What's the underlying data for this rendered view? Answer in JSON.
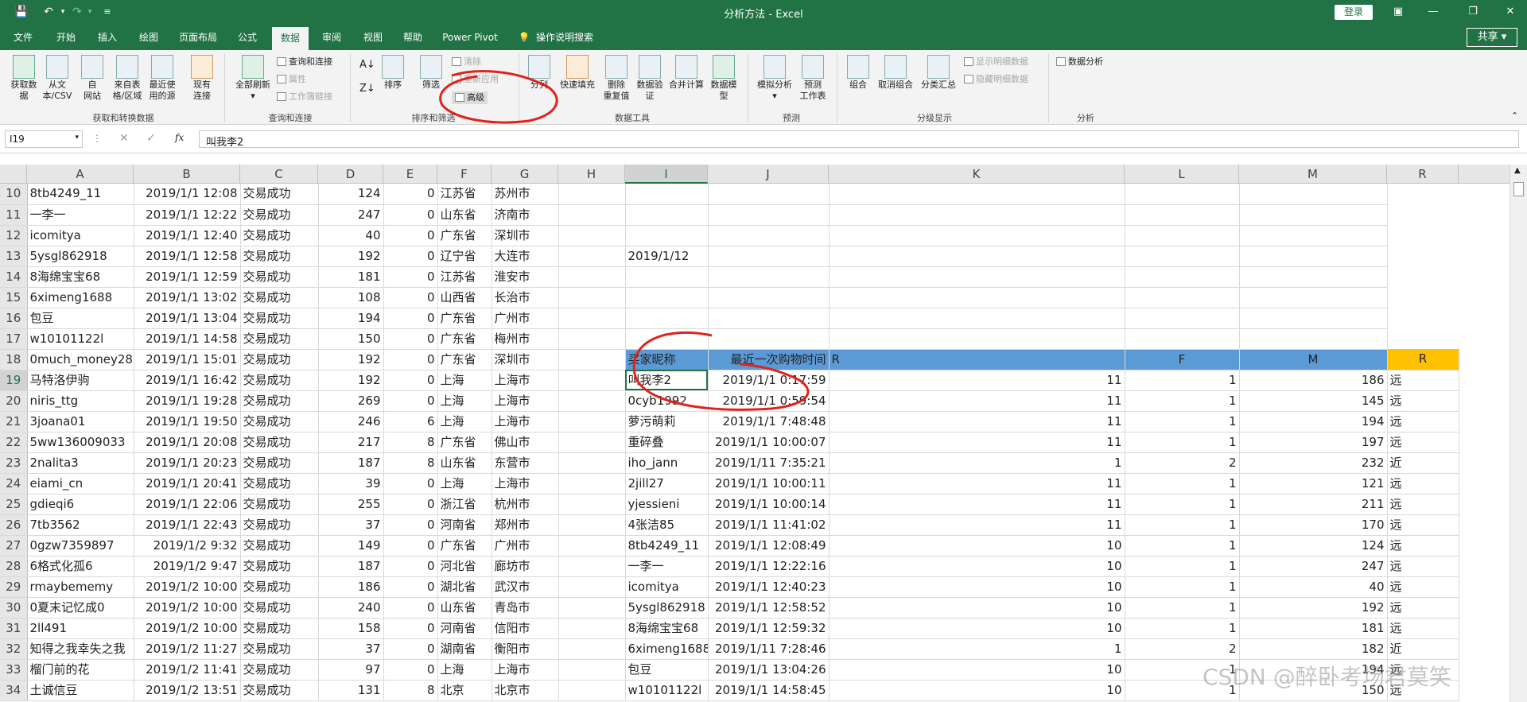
{
  "window": {
    "title": "分析方法  -  Excel",
    "login": "登录",
    "share": "共享"
  },
  "menu": {
    "tabs": [
      "文件",
      "开始",
      "插入",
      "绘图",
      "页面布局",
      "公式",
      "数据",
      "审阅",
      "视图",
      "帮助",
      "Power Pivot"
    ],
    "tell_me": "操作说明搜索"
  },
  "ribbon": {
    "get_data": [
      "获取数",
      "据"
    ],
    "from_csv": [
      "从文",
      "本/CSV"
    ],
    "from_web": [
      "自",
      "网站"
    ],
    "from_table": [
      "来自表",
      "格/区域"
    ],
    "recent": [
      "最近使",
      "用的源"
    ],
    "existing": [
      "现有",
      "连接"
    ],
    "group1": "获取和转换数据",
    "refresh_all": [
      "全部刷新"
    ],
    "queries": "查询和连接",
    "props": "属性",
    "edit_links": "工作簿链接",
    "group2": "查询和连接",
    "sort_label": "排序",
    "filter_label": "筛选",
    "clear": "清除",
    "reapply": "重新应用",
    "advanced": "高级",
    "group3": "排序和筛选",
    "split": "分列",
    "flash_fill": "快速填充",
    "remove_dup": [
      "删除",
      "重复值"
    ],
    "validate": [
      "数据验",
      "证"
    ],
    "consolidate": "合并计算",
    "model": [
      "数据模",
      "型"
    ],
    "group4": "数据工具",
    "what_if": [
      "模拟分析"
    ],
    "forecast": [
      "预测",
      "工作表"
    ],
    "group5": "预测",
    "grp_btn": "组合",
    "ungroup": "取消组合",
    "subtotal": "分类汇总",
    "show_detail": "显示明细数据",
    "hide_detail": "隐藏明细数据",
    "group6": "分级显示",
    "analysis": "数据分析",
    "group7": "分析"
  },
  "formula_bar": {
    "name_box": "I19",
    "formula": "叫我李2"
  },
  "columns": [
    "A",
    "B",
    "C",
    "D",
    "E",
    "F",
    "G",
    "H",
    "I",
    "J",
    "K",
    "L",
    "M",
    "R"
  ],
  "rows": [
    [
      "10",
      "8tb4249_11",
      "2019/1/1 12:08",
      "交易成功",
      "124",
      "0",
      "江苏省",
      "苏州市",
      "",
      "",
      "",
      "",
      "",
      ""
    ],
    [
      "11",
      "一李一",
      "2019/1/1 12:22",
      "交易成功",
      "247",
      "0",
      "山东省",
      "济南市",
      "",
      "",
      "",
      "",
      "",
      ""
    ],
    [
      "12",
      "icomitya",
      "2019/1/1 12:40",
      "交易成功",
      "40",
      "0",
      "广东省",
      "深圳市",
      "",
      "",
      "",
      "",
      "",
      ""
    ],
    [
      "13",
      "5ysgl862918",
      "2019/1/1 12:58",
      "交易成功",
      "192",
      "0",
      "辽宁省",
      "大连市",
      "",
      "2019/1/12",
      "",
      "",
      "",
      ""
    ],
    [
      "14",
      "8海绵宝宝68",
      "2019/1/1 12:59",
      "交易成功",
      "181",
      "0",
      "江苏省",
      "淮安市",
      "",
      "",
      "",
      "",
      "",
      ""
    ],
    [
      "15",
      "6ximeng1688",
      "2019/1/1 13:02",
      "交易成功",
      "108",
      "0",
      "山西省",
      "长治市",
      "",
      "",
      "",
      "",
      "",
      ""
    ],
    [
      "16",
      "包豆",
      "2019/1/1 13:04",
      "交易成功",
      "194",
      "0",
      "广东省",
      "广州市",
      "",
      "",
      "",
      "",
      "",
      ""
    ],
    [
      "17",
      "w10101122l",
      "2019/1/1 14:58",
      "交易成功",
      "150",
      "0",
      "广东省",
      "梅州市",
      "",
      "",
      "",
      "",
      "",
      ""
    ],
    [
      "18",
      "0much_money28",
      "2019/1/1 15:01",
      "交易成功",
      "192",
      "0",
      "广东省",
      "深圳市",
      "",
      "买家昵称",
      "最近一次购物时间",
      "R",
      "F",
      "M",
      "R"
    ],
    [
      "19",
      "马特洛伊驹",
      "2019/1/1 16:42",
      "交易成功",
      "192",
      "0",
      "上海",
      "上海市",
      "",
      "叫我李2",
      "2019/1/1 0:17:59",
      "11",
      "1",
      "186",
      "远"
    ],
    [
      "20",
      "niris_ttg",
      "2019/1/1 19:28",
      "交易成功",
      "269",
      "0",
      "上海",
      "上海市",
      "",
      "0cyb1992",
      "2019/1/1 0:59:54",
      "11",
      "1",
      "145",
      "远"
    ],
    [
      "21",
      "3joana01",
      "2019/1/1 19:50",
      "交易成功",
      "246",
      "6",
      "上海",
      "上海市",
      "",
      "萝污萌莉",
      "2019/1/1 7:48:48",
      "11",
      "1",
      "194",
      "远"
    ],
    [
      "22",
      "5ww136009033",
      "2019/1/1 20:08",
      "交易成功",
      "217",
      "8",
      "广东省",
      "佛山市",
      "",
      "重碎叠",
      "2019/1/1 10:00:07",
      "11",
      "1",
      "197",
      "远"
    ],
    [
      "23",
      "2nalita3",
      "2019/1/1 20:23",
      "交易成功",
      "187",
      "8",
      "山东省",
      "东营市",
      "",
      "iho_jann",
      "2019/1/11 7:35:21",
      "1",
      "2",
      "232",
      "近"
    ],
    [
      "24",
      "eiami_cn",
      "2019/1/1 20:41",
      "交易成功",
      "39",
      "0",
      "上海",
      "上海市",
      "",
      "2jill27",
      "2019/1/1 10:00:11",
      "11",
      "1",
      "121",
      "远"
    ],
    [
      "25",
      "gdieqi6",
      "2019/1/1 22:06",
      "交易成功",
      "255",
      "0",
      "浙江省",
      "杭州市",
      "",
      "yjessieni",
      "2019/1/1 10:00:14",
      "11",
      "1",
      "211",
      "远"
    ],
    [
      "26",
      "7tb3562",
      "2019/1/1 22:43",
      "交易成功",
      "37",
      "0",
      "河南省",
      "郑州市",
      "",
      "4张洁85",
      "2019/1/1 11:41:02",
      "11",
      "1",
      "170",
      "远"
    ],
    [
      "27",
      "0gzw7359897",
      "2019/1/2 9:32",
      "交易成功",
      "149",
      "0",
      "广东省",
      "广州市",
      "",
      "8tb4249_11",
      "2019/1/1 12:08:49",
      "10",
      "1",
      "124",
      "远"
    ],
    [
      "28",
      "6格式化孤6",
      "2019/1/2 9:47",
      "交易成功",
      "187",
      "0",
      "河北省",
      "廊坊市",
      "",
      "一李一",
      "2019/1/1 12:22:16",
      "10",
      "1",
      "247",
      "远"
    ],
    [
      "29",
      "rmaybememy",
      "2019/1/2 10:00",
      "交易成功",
      "186",
      "0",
      "湖北省",
      "武汉市",
      "",
      "icomitya",
      "2019/1/1 12:40:23",
      "10",
      "1",
      "40",
      "远"
    ],
    [
      "30",
      "0夏末记忆成0",
      "2019/1/2 10:00",
      "交易成功",
      "240",
      "0",
      "山东省",
      "青岛市",
      "",
      "5ysgl862918",
      "2019/1/1 12:58:52",
      "10",
      "1",
      "192",
      "远"
    ],
    [
      "31",
      "2ll491",
      "2019/1/2 10:00",
      "交易成功",
      "158",
      "0",
      "河南省",
      "信阳市",
      "",
      "8海绵宝宝68",
      "2019/1/1 12:59:32",
      "10",
      "1",
      "181",
      "远"
    ],
    [
      "32",
      "知得之我幸失之我",
      "2019/1/2 11:27",
      "交易成功",
      "37",
      "0",
      "湖南省",
      "衡阳市",
      "",
      "6ximeng1688",
      "2019/1/11 7:28:46",
      "1",
      "2",
      "182",
      "近"
    ],
    [
      "33",
      "榴门前的花",
      "2019/1/2 11:41",
      "交易成功",
      "97",
      "0",
      "上海",
      "上海市",
      "",
      "包豆",
      "2019/1/1 13:04:26",
      "10",
      "1",
      "194",
      "远"
    ],
    [
      "34",
      "土诚信豆",
      "2019/1/2 13:51",
      "交易成功",
      "131",
      "8",
      "北京",
      "北京市",
      "",
      "w10101122l",
      "2019/1/1 14:58:45",
      "10",
      "1",
      "150",
      "远"
    ]
  ],
  "watermark": "CSDN @醉卧考场君莫笑"
}
